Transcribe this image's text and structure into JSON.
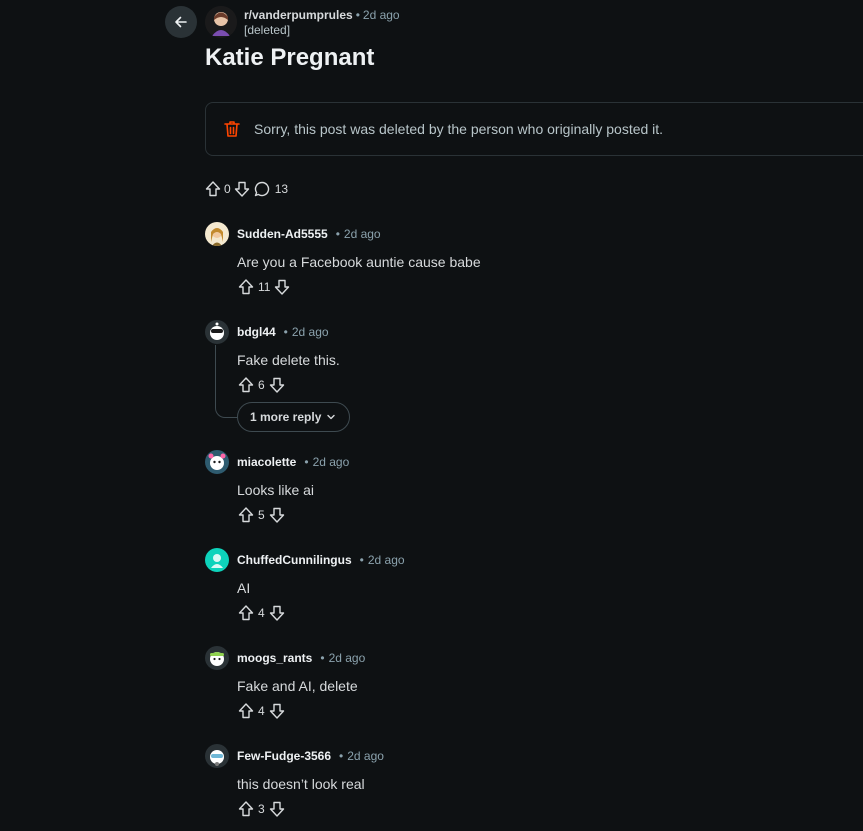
{
  "post": {
    "subreddit": "r/vanderpumprules",
    "time": "2d ago",
    "author": "[deleted]",
    "title": "Katie Pregnant",
    "deleted_message": "Sorry, this post was deleted by the person who originally posted it.",
    "score": "0",
    "comment_count": "13"
  },
  "comments": [
    {
      "user": "Sudden-Ad5555",
      "time": "2d ago",
      "body": "Are you a Facebook auntie cause babe",
      "score": "11"
    },
    {
      "user": "bdgl44",
      "time": "2d ago",
      "body": "Fake delete this.",
      "score": "6"
    },
    {
      "user": "miacolette",
      "time": "2d ago",
      "body": "Looks like ai",
      "score": "5"
    },
    {
      "user": "ChuffedCunnilingus",
      "time": "2d ago",
      "body": "AI",
      "score": "4"
    },
    {
      "user": "moogs_rants",
      "time": "2d ago",
      "body": "Fake and AI, delete",
      "score": "4"
    },
    {
      "user": "Few-Fudge-3566",
      "time": "2d ago",
      "body": "this doesn’t look real",
      "score": "3"
    }
  ],
  "more_replies_label": "1 more reply",
  "colors": {
    "background": "#0e1113",
    "trash_red": "#ff4500",
    "meta_gray": "#8ba2ad"
  }
}
